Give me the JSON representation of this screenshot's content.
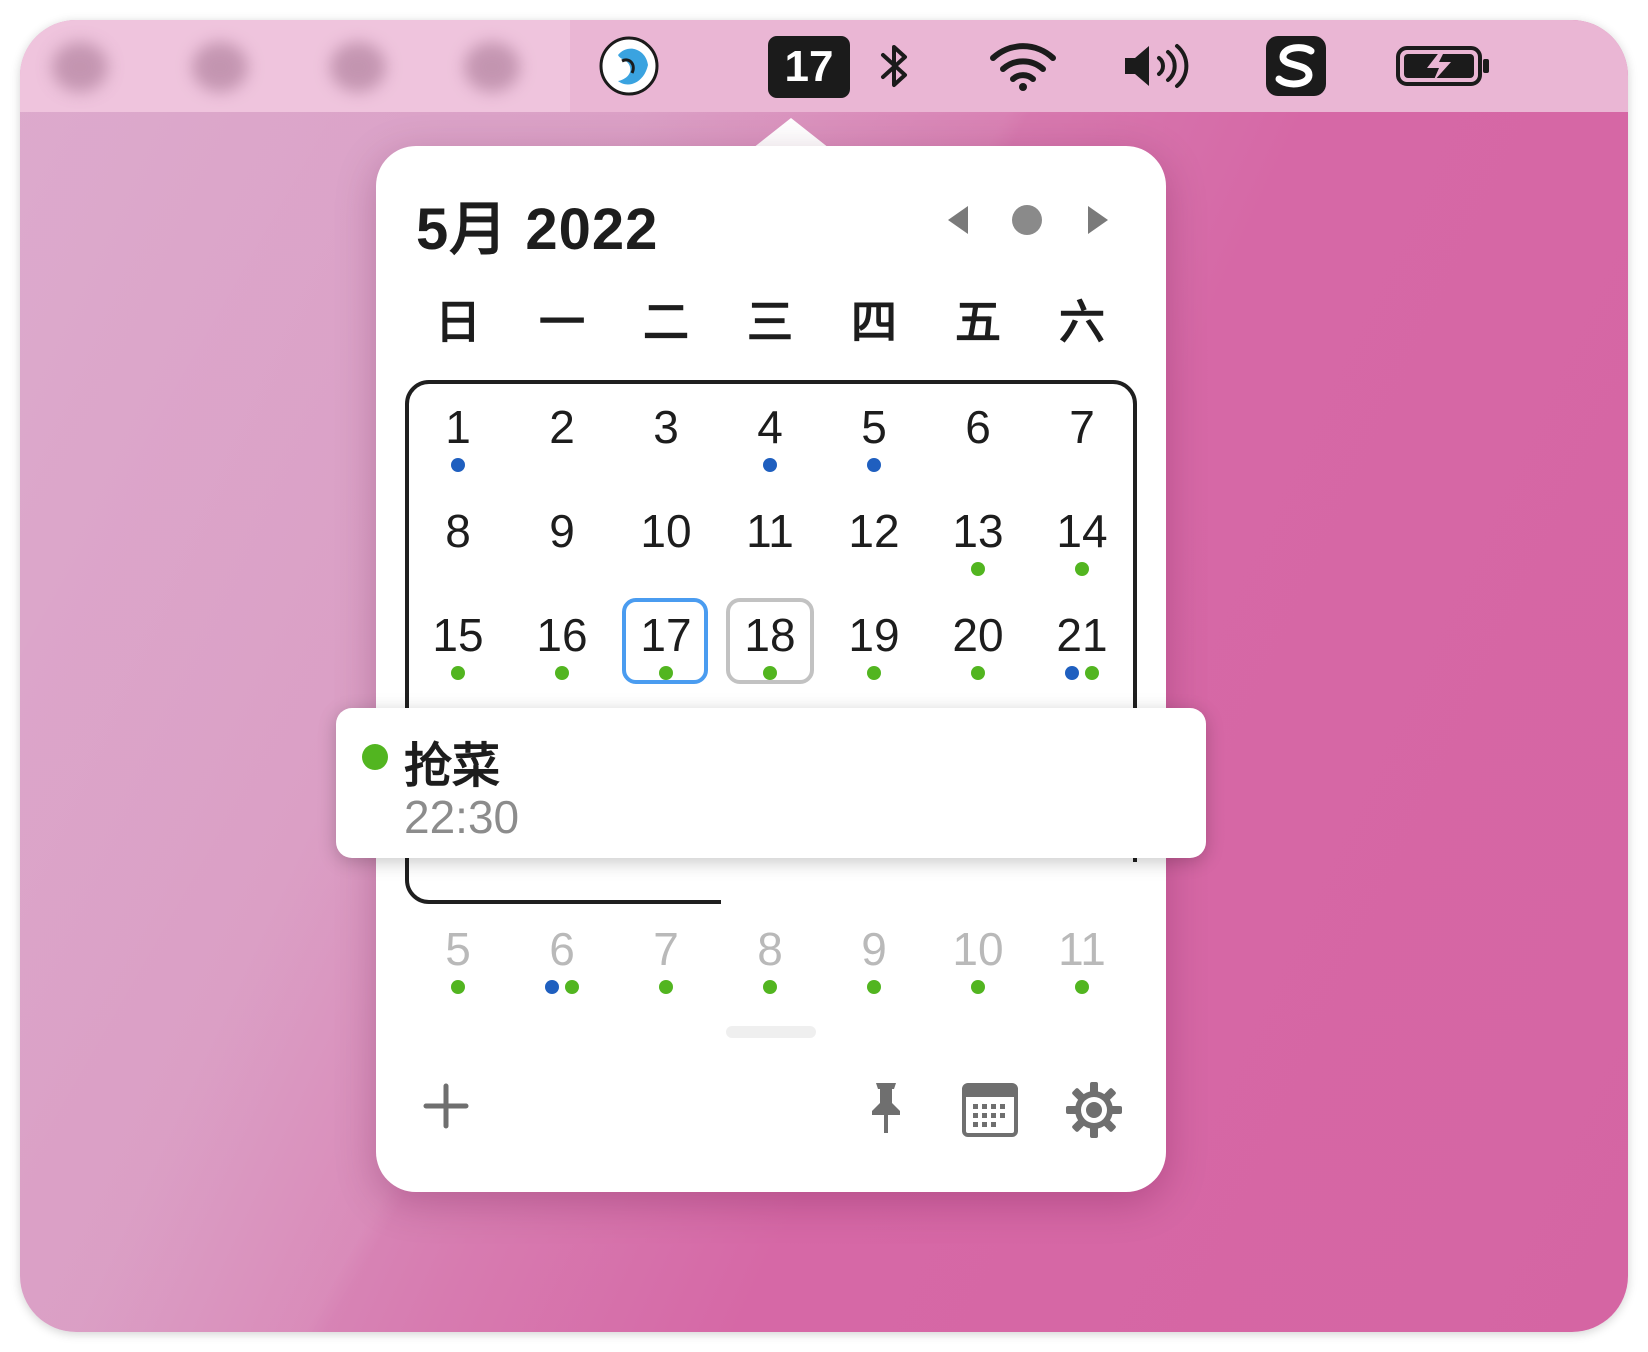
{
  "menubar": {
    "date_badge": "17",
    "icons": [
      "app-icon",
      "bluetooth-icon",
      "wifi-icon",
      "volume-icon",
      "sogou-input-icon",
      "battery-charging-icon"
    ]
  },
  "calendar": {
    "month_title": "5月 2022",
    "weekdays": [
      "日",
      "一",
      "二",
      "三",
      "四",
      "五",
      "六"
    ],
    "colors": {
      "green": "#52b520",
      "blue": "#1f5fbf",
      "today_outline": "#4a9cf0"
    },
    "rows": [
      [
        {
          "d": "1",
          "dots": [
            "blue"
          ]
        },
        {
          "d": "2",
          "dots": []
        },
        {
          "d": "3",
          "dots": []
        },
        {
          "d": "4",
          "dots": [
            "blue"
          ]
        },
        {
          "d": "5",
          "dots": [
            "blue"
          ]
        },
        {
          "d": "6",
          "dots": []
        },
        {
          "d": "7",
          "dots": []
        }
      ],
      [
        {
          "d": "8",
          "dots": []
        },
        {
          "d": "9",
          "dots": []
        },
        {
          "d": "10",
          "dots": []
        },
        {
          "d": "11",
          "dots": []
        },
        {
          "d": "12",
          "dots": []
        },
        {
          "d": "13",
          "dots": [
            "green"
          ]
        },
        {
          "d": "14",
          "dots": [
            "green"
          ]
        }
      ],
      [
        {
          "d": "15",
          "dots": [
            "green"
          ]
        },
        {
          "d": "16",
          "dots": [
            "green"
          ]
        },
        {
          "d": "17",
          "dots": [
            "green"
          ],
          "today": true
        },
        {
          "d": "18",
          "dots": [
            "green"
          ],
          "hover": true
        },
        {
          "d": "19",
          "dots": [
            "green"
          ]
        },
        {
          "d": "20",
          "dots": [
            "green"
          ]
        },
        {
          "d": "21",
          "dots": [
            "blue",
            "green"
          ]
        }
      ],
      [
        {
          "d": "",
          "dots": [
            "green"
          ]
        },
        {
          "d": "",
          "dots": [
            "green"
          ]
        },
        {
          "d": "",
          "dots": [
            "green"
          ]
        },
        {
          "d": "",
          "dots": [
            "blue",
            "green"
          ]
        },
        {
          "d": "",
          "dots": [
            "green"
          ]
        },
        {
          "d": "",
          "dots": [
            "blue",
            "green"
          ]
        },
        {
          "d": "",
          "dots": [
            "green"
          ]
        }
      ],
      [
        {
          "d": "5",
          "dots": [
            "green"
          ],
          "dim": true
        },
        {
          "d": "6",
          "dots": [
            "blue",
            "green"
          ],
          "dim": true
        },
        {
          "d": "7",
          "dots": [
            "green"
          ],
          "dim": true
        },
        {
          "d": "8",
          "dots": [
            "green"
          ],
          "dim": true
        },
        {
          "d": "9",
          "dots": [
            "green"
          ],
          "dim": true
        },
        {
          "d": "10",
          "dots": [
            "green"
          ],
          "dim": true
        },
        {
          "d": "11",
          "dots": [
            "green"
          ],
          "dim": true
        }
      ]
    ]
  },
  "event_card": {
    "title": "抢菜",
    "time": "22:30",
    "color": "#52b520"
  },
  "toolbar": {
    "icons": [
      "plus-icon",
      "pin-icon",
      "calendar-grid-icon",
      "gear-icon"
    ]
  }
}
